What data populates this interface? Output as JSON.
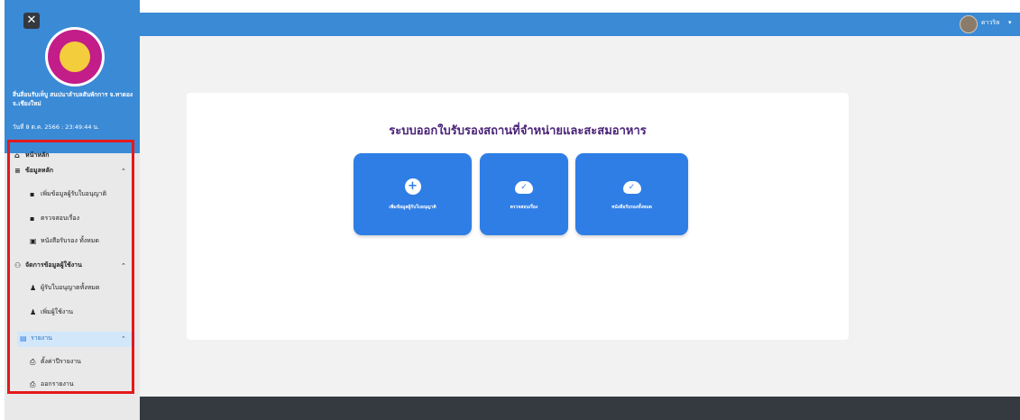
{
  "app": {
    "close_glyph": "✕",
    "org_name": "สิ่นสิ่อนรับเท็บู สนปนาลำบลสันพักการ จ.ทาดอง จ.เชียงใหม่",
    "datetime": "วันที่ 8 ต.ค. 2566 : 23:49:44 น."
  },
  "user": {
    "name": "ดาวริล",
    "caret": "▾"
  },
  "sidebar": {
    "items": [
      {
        "label": "หน้าหลัก",
        "icon": "home-icon",
        "glyph": "⌂"
      },
      {
        "label": "ข้อมูลหลัก",
        "icon": "database-icon",
        "glyph": "≡",
        "chevron": "⌃"
      },
      {
        "label": "เพิ่มข้อมูลผู้รับใบอนุญาติ",
        "icon": "form-icon",
        "glyph": "▪"
      },
      {
        "label": "ตรวจสอบเรื่อง",
        "icon": "check-icon",
        "glyph": "▪"
      },
      {
        "label": "หนังสือรับรอง ทั้งหมด",
        "icon": "documents-icon",
        "glyph": "▣"
      },
      {
        "label": "จัดการข้อมูลผู้ใช้งาน",
        "icon": "users-manage-icon",
        "glyph": "⚇",
        "chevron": "⌃"
      },
      {
        "label": "ผู้รับใบอนุญาตทั้งหมด",
        "icon": "user-icon",
        "glyph": "♟"
      },
      {
        "label": "เพิ่มผู้ใช้งาน",
        "icon": "add-user-icon",
        "glyph": "♟"
      },
      {
        "label": "รายงาน",
        "icon": "report-icon",
        "glyph": "▤",
        "chevron": "⌃"
      },
      {
        "label": "ตั้งค่าปีรายงาน",
        "icon": "printer-icon",
        "glyph": "⎙"
      },
      {
        "label": "ออกรายงาน",
        "icon": "printer-icon",
        "glyph": "⎙"
      }
    ]
  },
  "main": {
    "title": "ระบบออกใบรับรองสถานที่จำหน่ายและสะสมอาหาร",
    "tiles": [
      {
        "label": "เพิ่มข้อมูลผู้รับใบอนุญาติ",
        "icon": "plus-circle-icon",
        "glyph": "+"
      },
      {
        "label": "ตรวจสอบเรื่อง",
        "icon": "cloud-check-icon",
        "glyph": "✓"
      },
      {
        "label": "หนังสือรับรองทั้งหมด",
        "icon": "cloud-check-icon",
        "glyph": "✓"
      }
    ]
  },
  "colors": {
    "header_blue": "#3a8ad6",
    "tile_blue": "#2e7ee6",
    "title_purple": "#4a2378",
    "highlight_red": "#e3191a",
    "footer_dark": "#343a40"
  }
}
